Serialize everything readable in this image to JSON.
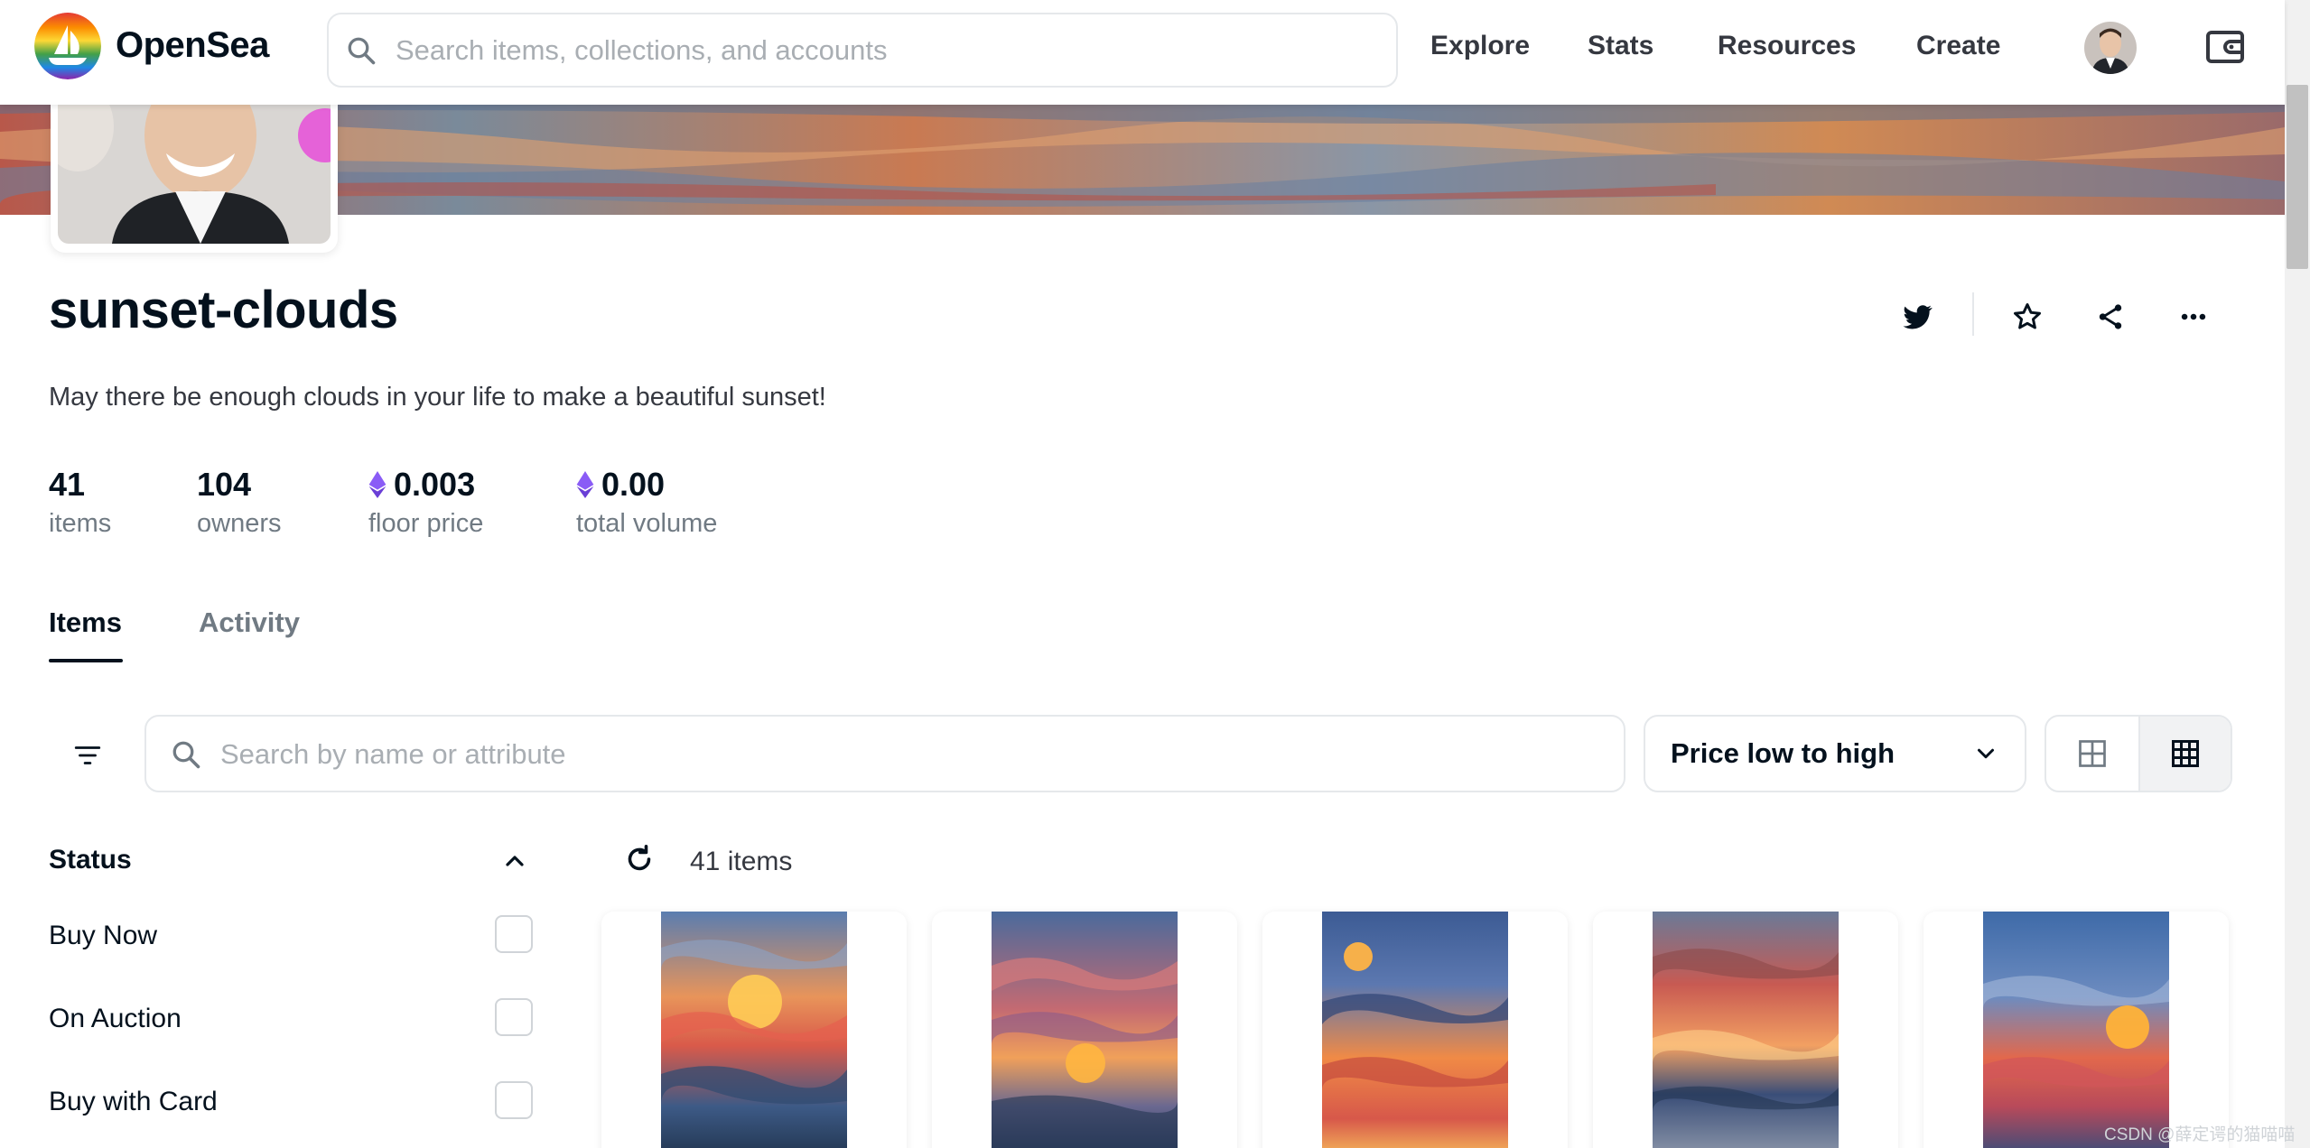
{
  "nav": {
    "brand": "OpenSea",
    "search_placeholder": "Search items, collections, and accounts",
    "links": [
      "Explore",
      "Stats",
      "Resources",
      "Create"
    ]
  },
  "collection": {
    "name": "sunset-clouds",
    "description": "May there be enough clouds in your life to make a beautiful sunset!",
    "stats": [
      {
        "value": "41",
        "label": "items",
        "eth": false
      },
      {
        "value": "104",
        "label": "owners",
        "eth": false
      },
      {
        "value": "0.003",
        "label": "floor price",
        "eth": true
      },
      {
        "value": "0.00",
        "label": "total volume",
        "eth": true
      }
    ]
  },
  "tabs": [
    "Items",
    "Activity"
  ],
  "toolbar": {
    "search_placeholder": "Search by name or attribute",
    "sort_label": "Price low to high"
  },
  "sidebar": {
    "status_title": "Status",
    "status_options": [
      "Buy Now",
      "On Auction",
      "Buy with Card"
    ]
  },
  "results": {
    "count_label": "41 items"
  },
  "watermark": "CSDN @薛定谔的猫喵喵",
  "colors": {
    "eth": "#8a5cf6",
    "accent": "#2081e2",
    "text": "#04111d",
    "muted": "#707a83"
  }
}
